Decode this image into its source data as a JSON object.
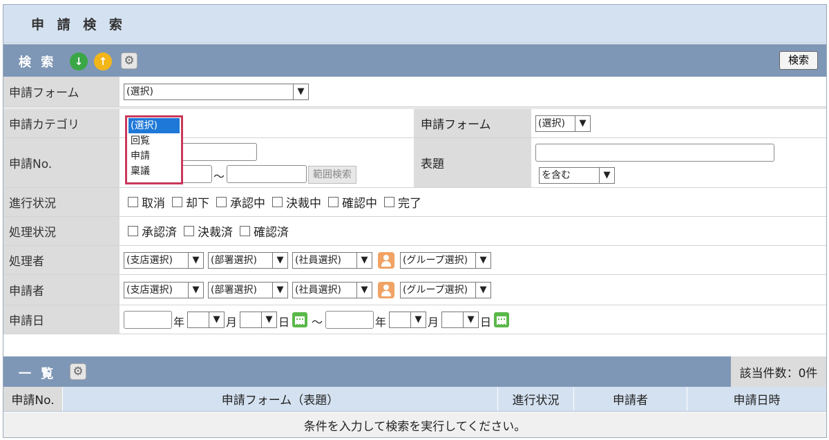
{
  "title": "申 請 検 索",
  "search_section": {
    "label": "検 索",
    "download_icon": "↓",
    "upload_icon": "↑",
    "search_button": "検索"
  },
  "rows": {
    "form_top": {
      "label": "申請フォーム",
      "value": "(選択)"
    },
    "category": {
      "label": "申請カテゴリ",
      "value": "(選択)"
    },
    "form_right": {
      "label": "申請フォーム",
      "value": "(選択)"
    },
    "app_no": {
      "label": "申請No.",
      "tilde": "〜",
      "range_button": "範囲検索"
    },
    "subject": {
      "label": "表題",
      "match": "を含む"
    },
    "progress": {
      "label": "進行状況",
      "options": [
        "取消",
        "却下",
        "承認中",
        "決裁中",
        "確認中",
        "完了"
      ]
    },
    "processing": {
      "label": "処理状況",
      "options": [
        "承認済",
        "決裁済",
        "確認済"
      ]
    },
    "processor": {
      "label": "処理者",
      "branch": "(支店選択)",
      "dept": "(部署選択)",
      "employee": "(社員選択)",
      "group": "(グループ選択)"
    },
    "applicant": {
      "label": "申請者",
      "branch": "(支店選択)",
      "dept": "(部署選択)",
      "employee": "(社員選択)",
      "group": "(グループ選択)"
    },
    "date": {
      "label": "申請日",
      "year": "年",
      "month": "月",
      "day": "日",
      "tilde": "〜"
    }
  },
  "category_dropdown": [
    "(選択)",
    "回覧",
    "申請",
    "稟議"
  ],
  "list_section": {
    "label": "一 覧",
    "count": "該当件数：0件",
    "columns": [
      "申請No.",
      "申請フォーム（表題）",
      "進行状況",
      "申請者",
      "申請日時"
    ],
    "empty_message": "条件を入力して検索を実行してください。"
  },
  "colors": {
    "header_bar": "#7f97b6",
    "title_bar": "#d4e1f0",
    "dropdown_border": "#c8385a",
    "selected_option": "#1e78d7"
  }
}
